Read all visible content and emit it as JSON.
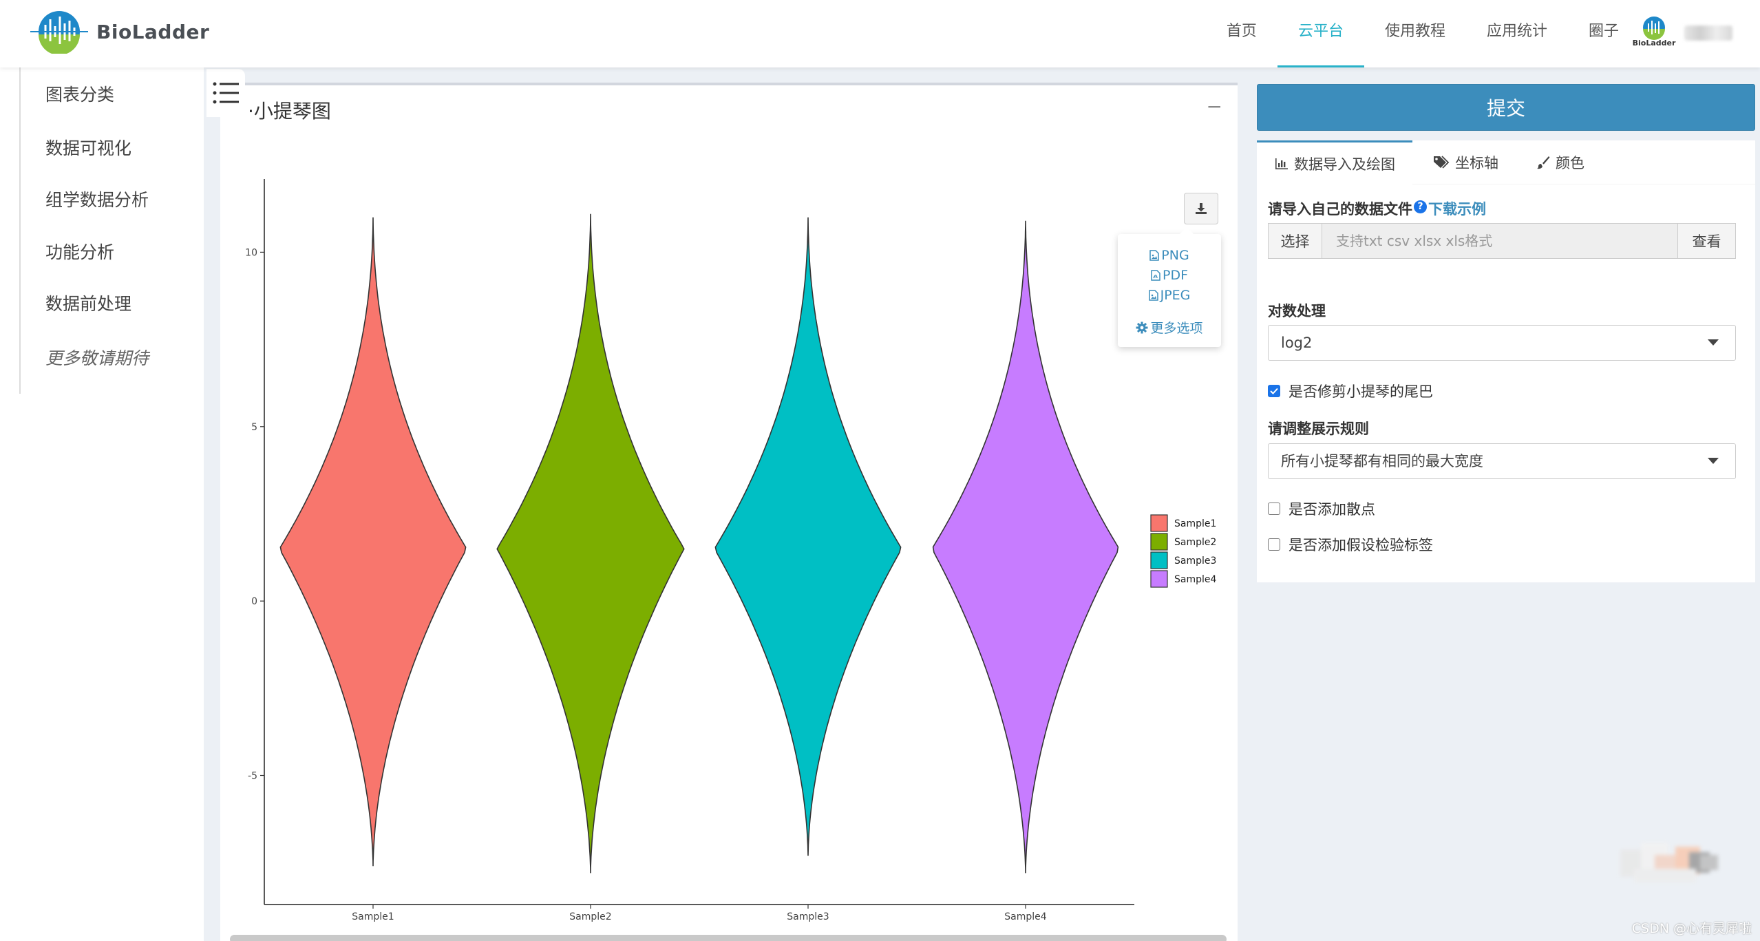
{
  "navbar": {
    "logo_text": "BioLadder",
    "items": [
      {
        "label": "首页",
        "active": false
      },
      {
        "label": "云平台",
        "active": true
      },
      {
        "label": "使用教程",
        "active": false
      },
      {
        "label": "应用统计",
        "active": false
      },
      {
        "label": "圈子",
        "active": false
      }
    ],
    "user_logo_text": "BioLadder"
  },
  "sidebar": {
    "items": [
      {
        "label": "图表分类"
      },
      {
        "label": "数据可视化"
      },
      {
        "label": "组学数据分析"
      },
      {
        "label": "功能分析"
      },
      {
        "label": "数据前处理"
      },
      {
        "label": "更多敬请期待"
      }
    ]
  },
  "main": {
    "title": "·小提琴图",
    "collapse": "−",
    "download_menu": {
      "png": "PNG",
      "pdf": "PDF",
      "jpeg": "JPEG",
      "more": "更多选项"
    }
  },
  "right": {
    "submit_label": "提交",
    "tabs": [
      {
        "label": "数据导入及绘图",
        "icon": "bar-chart-icon",
        "active": true
      },
      {
        "label": "坐标轴",
        "icon": "tags-icon",
        "active": false
      },
      {
        "label": "颜色",
        "icon": "paintbrush-icon",
        "active": false
      }
    ],
    "import_label": "请导入自己的数据文件",
    "help_glyph": "?",
    "download_example": "下载示例",
    "file_button": "选择",
    "file_placeholder": "支持txt csv xlsx xls格式",
    "view_button": "查看",
    "log_label": "对数处理",
    "log_value": "log2",
    "trim_label": "是否修剪小提琴的尾巴",
    "trim_checked": true,
    "rule_label": "请调整展示规则",
    "rule_value": "所有小提琴都有相同的最大宽度",
    "points_label": "是否添加散点",
    "points_checked": false,
    "test_label": "是否添加假设检验标签",
    "test_checked": false
  },
  "watermark": "CSDN @心有灵犀啦",
  "colors": {
    "accent": "#29b2c9",
    "primary": "#3c8dbc",
    "sample1": "#f8766d",
    "sample2": "#7cae00",
    "sample3": "#00bfc4",
    "sample4": "#c77cff"
  },
  "chart_data": {
    "type": "violin",
    "categories": [
      "Sample1",
      "Sample2",
      "Sample3",
      "Sample4"
    ],
    "yticks": [
      -5,
      0,
      5,
      10
    ],
    "ylim": [
      -8.7,
      12.1
    ],
    "legend": [
      "Sample1",
      "Sample2",
      "Sample3",
      "Sample4"
    ],
    "legend_position": "right",
    "series": [
      {
        "name": "Sample1",
        "color": "#f8766d",
        "min": -7.6,
        "max": 11.0,
        "center": 1.5
      },
      {
        "name": "Sample2",
        "color": "#7cae00",
        "min": -7.8,
        "max": 11.1,
        "center": 1.5
      },
      {
        "name": "Sample3",
        "color": "#00bfc4",
        "min": -7.3,
        "max": 11.0,
        "center": 1.5
      },
      {
        "name": "Sample4",
        "color": "#c77cff",
        "min": -7.8,
        "max": 10.9,
        "center": 1.5
      }
    ]
  }
}
